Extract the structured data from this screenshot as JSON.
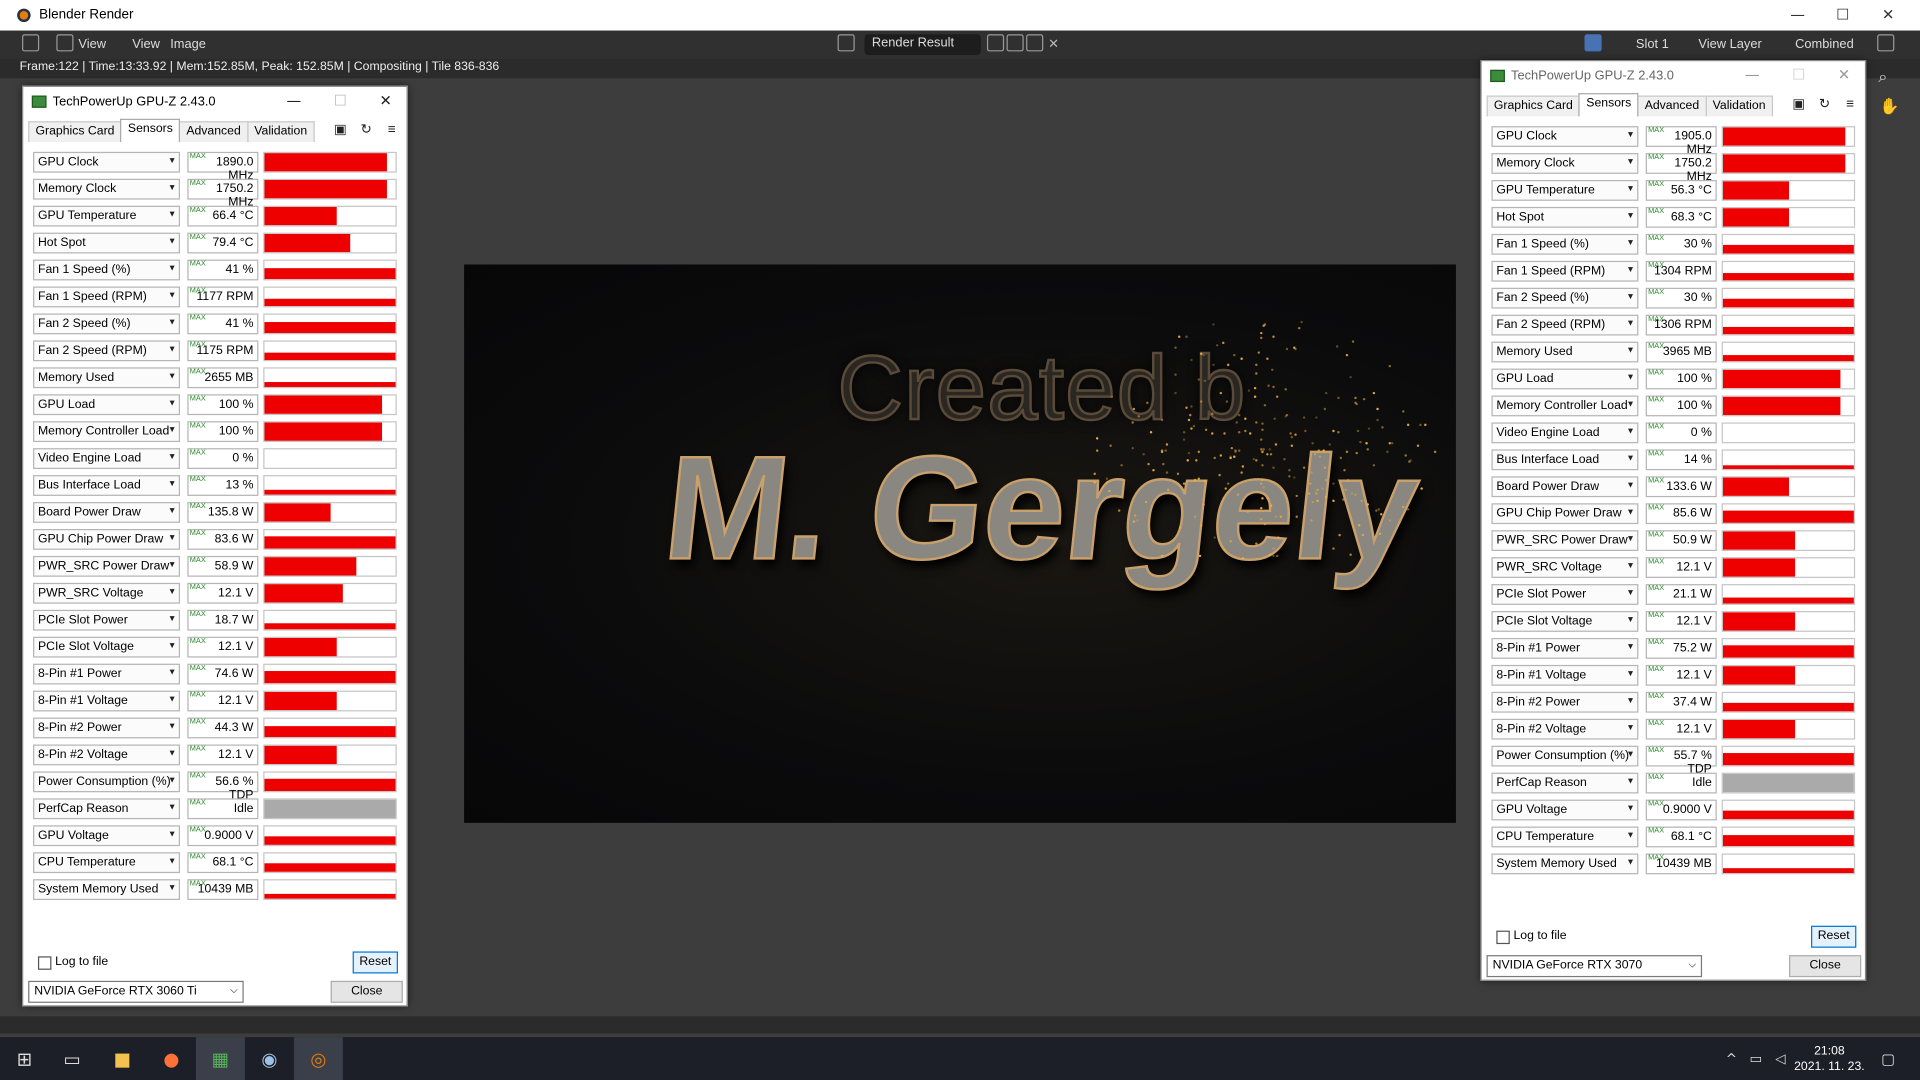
{
  "window": {
    "title": "Blender Render",
    "min": "—",
    "max": "☐",
    "close": "✕"
  },
  "header": {
    "view1": "View",
    "view2": "View",
    "image": "Image",
    "render_result": "Render Result",
    "slot": "Slot 1",
    "view_layer": "View Layer",
    "pass": "Combined"
  },
  "info": "Frame:122 | Time:13:33.92 | Mem:152.85M, Peak: 152.85M | Compositing | Tile 836-836",
  "render": {
    "line1": "Created b",
    "line2": "M. Gergely"
  },
  "taskbar": {
    "time": "21:08",
    "date": "2021. 11. 23."
  },
  "gpuz_left": {
    "title": "TechPowerUp GPU-Z 2.43.0",
    "tabs": [
      "Graphics Card",
      "Sensors",
      "Advanced",
      "Validation"
    ],
    "sensors": [
      {
        "name": "GPU Clock",
        "value": "1890.0 MHz",
        "fill": 0.93
      },
      {
        "name": "Memory Clock",
        "value": "1750.2 MHz",
        "fill": 0.93
      },
      {
        "name": "GPU Temperature",
        "value": "66.4 °C",
        "fill": 0.55
      },
      {
        "name": "Hot Spot",
        "value": "79.4 °C",
        "fill": 0.65
      },
      {
        "name": "Fan 1 Speed (%)",
        "value": "41 %",
        "fill": 0.38
      },
      {
        "name": "Fan 1 Speed (RPM)",
        "value": "1177 RPM",
        "fill": 0.2
      },
      {
        "name": "Fan 2 Speed (%)",
        "value": "41 %",
        "fill": 0.38
      },
      {
        "name": "Fan 2 Speed (RPM)",
        "value": "1175 RPM",
        "fill": 0.2
      },
      {
        "name": "Memory Used",
        "value": "2655 MB",
        "fill": 0.1
      },
      {
        "name": "GPU Load",
        "value": "100 %",
        "fill": 0.9
      },
      {
        "name": "Memory Controller Load",
        "value": "100 %",
        "fill": 0.9
      },
      {
        "name": "Video Engine Load",
        "value": "0 %",
        "fill": 0
      },
      {
        "name": "Bus Interface Load",
        "value": "13 %",
        "fill": 0.04
      },
      {
        "name": "Board Power Draw",
        "value": "135.8 W",
        "fill": 0.5
      },
      {
        "name": "GPU Chip Power Draw",
        "value": "83.6 W",
        "fill": 0.45
      },
      {
        "name": "PWR_SRC Power Draw",
        "value": "58.9 W",
        "fill": 0.7
      },
      {
        "name": "PWR_SRC Voltage",
        "value": "12.1 V",
        "fill": 0.6
      },
      {
        "name": "PCIe Slot Power",
        "value": "18.7 W",
        "fill": 0.15
      },
      {
        "name": "PCIe Slot Voltage",
        "value": "12.1 V",
        "fill": 0.55
      },
      {
        "name": "8-Pin #1 Power",
        "value": "74.6 W",
        "fill": 0.45
      },
      {
        "name": "8-Pin #1 Voltage",
        "value": "12.1 V",
        "fill": 0.55
      },
      {
        "name": "8-Pin #2 Power",
        "value": "44.3 W",
        "fill": 0.4
      },
      {
        "name": "8-Pin #2 Voltage",
        "value": "12.1 V",
        "fill": 0.55
      },
      {
        "name": "Power Consumption (%)",
        "value": "56.6 % TDP",
        "fill": 0.45
      },
      {
        "name": "PerfCap Reason",
        "value": "Idle",
        "fill": 1,
        "gray": true
      },
      {
        "name": "GPU Voltage",
        "value": "0.9000 V",
        "fill": 0.3
      },
      {
        "name": "CPU Temperature",
        "value": "68.1 °C",
        "fill": 0.3
      },
      {
        "name": "System Memory Used",
        "value": "10439 MB",
        "fill": 0.08
      }
    ],
    "log": "Log to file",
    "reset": "Reset",
    "gpu": "NVIDIA GeForce RTX 3060 Ti",
    "close": "Close"
  },
  "gpuz_right": {
    "title": "TechPowerUp GPU-Z 2.43.0",
    "tabs": [
      "Graphics Card",
      "Sensors",
      "Advanced",
      "Validation"
    ],
    "sensors": [
      {
        "name": "GPU Clock",
        "value": "1905.0 MHz",
        "fill": 0.93
      },
      {
        "name": "Memory Clock",
        "value": "1750.2 MHz",
        "fill": 0.93
      },
      {
        "name": "GPU Temperature",
        "value": "56.3 °C",
        "fill": 0.5
      },
      {
        "name": "Hot Spot",
        "value": "68.3 °C",
        "fill": 0.5
      },
      {
        "name": "Fan 1 Speed (%)",
        "value": "30 %",
        "fill": 0.25
      },
      {
        "name": "Fan 1 Speed (RPM)",
        "value": "1304 RPM",
        "fill": 0.2
      },
      {
        "name": "Fan 2 Speed (%)",
        "value": "30 %",
        "fill": 0.25
      },
      {
        "name": "Fan 2 Speed (RPM)",
        "value": "1306 RPM",
        "fill": 0.2
      },
      {
        "name": "Memory Used",
        "value": "3965 MB",
        "fill": 0.15
      },
      {
        "name": "GPU Load",
        "value": "100 %",
        "fill": 0.9
      },
      {
        "name": "Memory Controller Load",
        "value": "100 %",
        "fill": 0.9
      },
      {
        "name": "Video Engine Load",
        "value": "0 %",
        "fill": 0
      },
      {
        "name": "Bus Interface Load",
        "value": "14 %",
        "fill": 0.03
      },
      {
        "name": "Board Power Draw",
        "value": "133.6 W",
        "fill": 0.5
      },
      {
        "name": "GPU Chip Power Draw",
        "value": "85.6 W",
        "fill": 0.45
      },
      {
        "name": "PWR_SRC Power Draw",
        "value": "50.9 W",
        "fill": 0.55
      },
      {
        "name": "PWR_SRC Voltage",
        "value": "12.1 V",
        "fill": 0.55
      },
      {
        "name": "PCIe Slot Power",
        "value": "21.1 W",
        "fill": 0.15
      },
      {
        "name": "PCIe Slot Voltage",
        "value": "12.1 V",
        "fill": 0.55
      },
      {
        "name": "8-Pin #1 Power",
        "value": "75.2 W",
        "fill": 0.45
      },
      {
        "name": "8-Pin #1 Voltage",
        "value": "12.1 V",
        "fill": 0.55
      },
      {
        "name": "8-Pin #2 Power",
        "value": "37.4 W",
        "fill": 0.3
      },
      {
        "name": "8-Pin #2 Voltage",
        "value": "12.1 V",
        "fill": 0.55
      },
      {
        "name": "Power Consumption (%)",
        "value": "55.7 % TDP",
        "fill": 0.45
      },
      {
        "name": "PerfCap Reason",
        "value": "Idle",
        "fill": 1,
        "gray": true
      },
      {
        "name": "GPU Voltage",
        "value": "0.9000 V",
        "fill": 0.3
      },
      {
        "name": "CPU Temperature",
        "value": "68.1 °C",
        "fill": 0.4
      },
      {
        "name": "System Memory Used",
        "value": "10439 MB",
        "fill": 0.08
      }
    ],
    "log": "Log to file",
    "reset": "Reset",
    "gpu": "NVIDIA GeForce RTX 3070",
    "close": "Close"
  }
}
